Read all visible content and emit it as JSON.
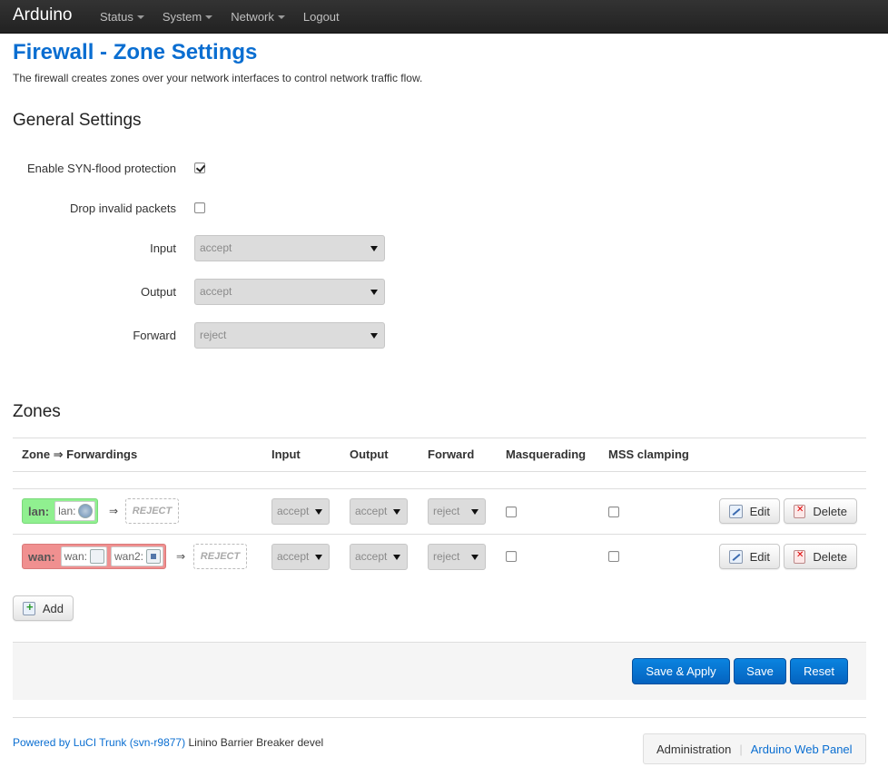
{
  "topbar": {
    "brand": "Arduino",
    "menu": [
      {
        "label": "Status",
        "has_dropdown": true
      },
      {
        "label": "System",
        "has_dropdown": true
      },
      {
        "label": "Network",
        "has_dropdown": true
      },
      {
        "label": "Logout",
        "has_dropdown": false
      }
    ]
  },
  "page": {
    "title": "Firewall - Zone Settings",
    "description": "The firewall creates zones over your network interfaces to control network traffic flow."
  },
  "general": {
    "heading": "General Settings",
    "syn_flood_label": "Enable SYN-flood protection",
    "syn_flood_checked": true,
    "drop_invalid_label": "Drop invalid packets",
    "drop_invalid_checked": false,
    "input_label": "Input",
    "input_value": "accept",
    "output_label": "Output",
    "output_value": "accept",
    "forward_label": "Forward",
    "forward_value": "reject"
  },
  "zones": {
    "heading": "Zones",
    "columns": [
      "Zone ⇒ Forwardings",
      "Input",
      "Output",
      "Forward",
      "Masquerading",
      "MSS clamping"
    ],
    "arrow": "⇒",
    "rows": [
      {
        "name": "lan:",
        "interfaces": [
          {
            "label": "lan:",
            "icon": "wireless-icon"
          }
        ],
        "forward_target": "REJECT",
        "input": "accept",
        "output": "accept",
        "forward": "reject",
        "masquerading": false,
        "mss_clamping": false,
        "edit_label": "Edit",
        "delete_label": "Delete"
      },
      {
        "name": "wan:",
        "interfaces": [
          {
            "label": "wan:",
            "icon": "ethernet-icon"
          },
          {
            "label": "wan2:",
            "icon": "network-icon"
          }
        ],
        "forward_target": "REJECT",
        "input": "accept",
        "output": "accept",
        "forward": "reject",
        "masquerading": false,
        "mss_clamping": false,
        "edit_label": "Edit",
        "delete_label": "Delete"
      }
    ],
    "add_label": "Add"
  },
  "actions": {
    "save_apply": "Save & Apply",
    "save": "Save",
    "reset": "Reset"
  },
  "footer": {
    "powered_by": "Powered by LuCI Trunk (svn-r9877)",
    "version": "Linino Barrier Breaker devel",
    "admin_label": "Administration",
    "separator": "|",
    "panel_link": "Arduino Web Panel"
  },
  "colors": {
    "accent": "#0a6ed1",
    "lan_zone": "#90f090",
    "wan_zone": "#f09090",
    "topbar": "#222222"
  }
}
